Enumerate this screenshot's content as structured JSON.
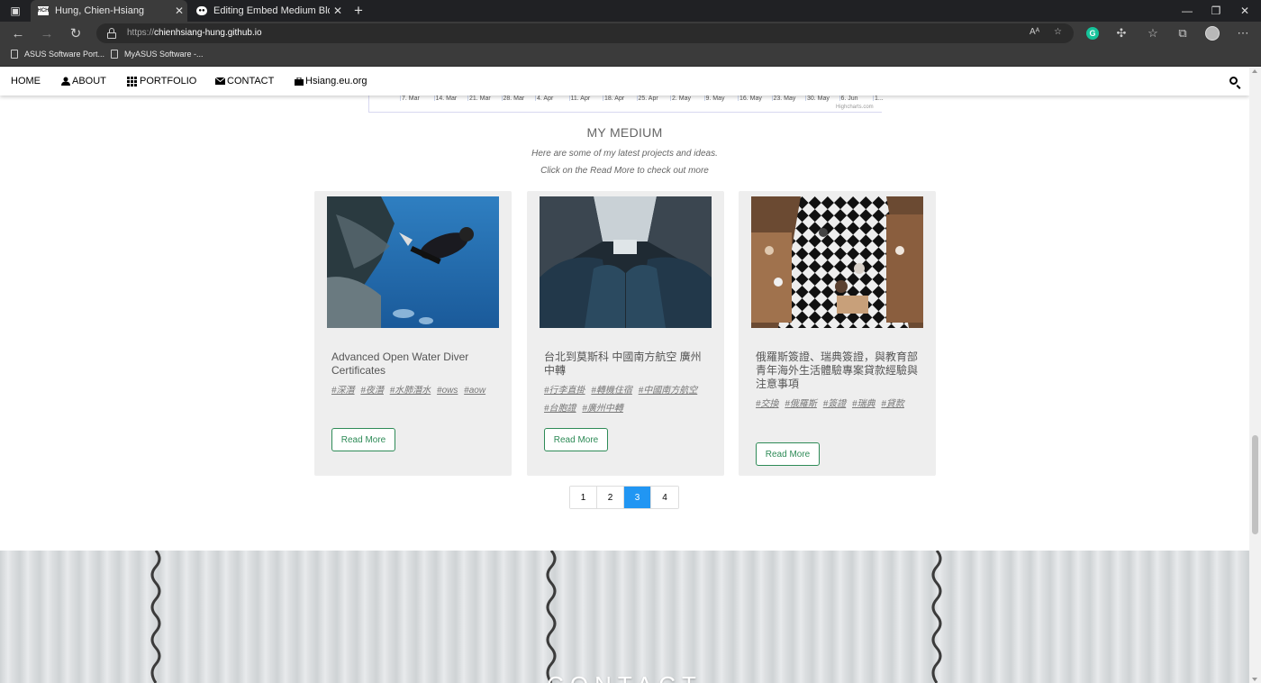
{
  "browser": {
    "tabs": [
      {
        "title": "Hung, Chien-Hsiang",
        "favicon_text": "HCH",
        "active": true
      },
      {
        "title": "Editing Embed Medium Blog On",
        "favicon_text": "●●",
        "active": false
      }
    ],
    "url_scheme": "https://",
    "url_host": "chienhsiang-hung.github.io",
    "bookmarks": [
      "ASUS Software Port...",
      "MyASUS Software -..."
    ]
  },
  "nav": {
    "items": [
      {
        "label": "HOME"
      },
      {
        "label": "ABOUT"
      },
      {
        "label": "PORTFOLIO"
      },
      {
        "label": "CONTACT"
      },
      {
        "label": "Hsiang.eu.org"
      }
    ]
  },
  "chart_strip": {
    "ticks": [
      "7. Mar",
      "14. Mar",
      "21. Mar",
      "28. Mar",
      "4. Apr",
      "11. Apr",
      "18. Apr",
      "25. Apr",
      "2. May",
      "9. May",
      "16. May",
      "23. May",
      "30. May",
      "6. Jun",
      "1..."
    ],
    "credit": "Highcharts.com"
  },
  "medium": {
    "title": "MY MEDIUM",
    "subtitle1": "Here are some of my latest projects and ideas.",
    "subtitle2": "Click on the Read More to check out more",
    "read_more": "Read More",
    "cards": [
      {
        "title": "Advanced Open Water Diver Certificates",
        "tags": [
          "#深潛",
          "#夜潛",
          "#水肺潛水",
          "#ows",
          "#aow"
        ]
      },
      {
        "title": "台北到莫斯科 中國南方航空 廣州中轉",
        "tags": [
          "#行李直掛",
          "#轉機住宿",
          "#中國南方航空",
          "#台胞證",
          "#廣州中轉"
        ]
      },
      {
        "title": "俄羅斯簽證、瑞典簽證，與教育部青年海外生活體驗專案貸款經驗與注意事項",
        "tags": [
          "#交換",
          "#俄羅斯",
          "#簽證",
          "#瑞典",
          "#貸款"
        ]
      }
    ]
  },
  "pagination": {
    "pages": [
      "1",
      "2",
      "3",
      "4"
    ],
    "current": "3"
  },
  "contact": {
    "heading": "CONTACT"
  },
  "colors": {
    "accent": "#2196f3",
    "read_more": "#2e8b57",
    "card_bg": "#eeeeee",
    "chrome_dark": "#202124"
  }
}
